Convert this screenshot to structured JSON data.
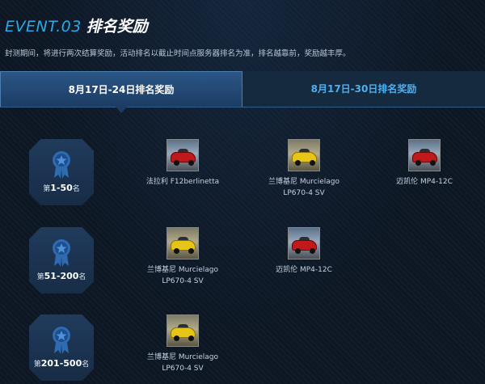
{
  "header": {
    "event_number": "EVENT.03",
    "event_title": "排名奖励",
    "description": "封测期间，将进行两次结算奖励，活动排名以截止时间点服务器排名为准，排名越靠前，奖励越丰厚。"
  },
  "tabs": [
    {
      "label": "8月17日-24日排名奖励",
      "active": true
    },
    {
      "label": "8月17日-30日排名奖励",
      "active": false
    }
  ],
  "colors": {
    "accent": "#2aa8e8",
    "tab_active": "#2b5686",
    "inactive_tab_text": "#4fb0f0"
  },
  "ranks": [
    {
      "prefix": "第",
      "range": "1-50",
      "suffix": "名",
      "rewards": [
        {
          "name_line1": "法拉利 F12berlinetta",
          "name_line2": "",
          "car_color": "red"
        },
        {
          "name_line1": "兰博基尼 Murcielago",
          "name_line2": "LP670-4 SV",
          "car_color": "yellow"
        },
        {
          "name_line1": "迈凯伦 MP4-12C",
          "name_line2": "",
          "car_color": "red"
        }
      ]
    },
    {
      "prefix": "第",
      "range": "51-200",
      "suffix": "名",
      "rewards": [
        {
          "name_line1": "兰博基尼 Murcielago",
          "name_line2": "LP670-4 SV",
          "car_color": "yellow"
        },
        {
          "name_line1": "迈凯伦 MP4-12C",
          "name_line2": "",
          "car_color": "red"
        }
      ]
    },
    {
      "prefix": "第",
      "range": "201-500",
      "suffix": "名",
      "rewards": [
        {
          "name_line1": "兰博基尼 Murcielago",
          "name_line2": "LP670-4 SV",
          "car_color": "yellow"
        }
      ]
    }
  ]
}
